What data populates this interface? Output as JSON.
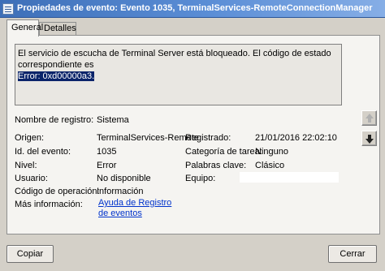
{
  "window": {
    "title": "Propiedades de evento: Evento 1035, TerminalServices-RemoteConnectionManager"
  },
  "tabs": [
    {
      "label": "General",
      "active": true
    },
    {
      "label": "Detalles",
      "active": false
    }
  ],
  "message": {
    "line1": "El servicio de escucha de Terminal Server está bloqueado. El código de estado correspondiente es",
    "line2_selected": "Error: 0xd00000a3."
  },
  "fields": {
    "nombre_registro": {
      "label": "Nombre de registro:",
      "value": "Sistema"
    },
    "origen": {
      "label": "Origen:",
      "value": "TerminalServices-Remote"
    },
    "registrado": {
      "label": "Registrado:",
      "value": "21/01/2016 22:02:10"
    },
    "id_evento": {
      "label": "Id. del evento:",
      "value": "1035"
    },
    "categoria_tarea": {
      "label": "Categoría de tarea:",
      "value": "Ninguno"
    },
    "nivel": {
      "label": "Nivel:",
      "value": "Error"
    },
    "palabras_clave": {
      "label": "Palabras clave:",
      "value": "Clásico"
    },
    "usuario": {
      "label": "Usuario:",
      "value": "No disponible"
    },
    "equipo": {
      "label": "Equipo:",
      "value": ""
    },
    "codigo_operacion": {
      "label": "Código de operación:",
      "value": "Información"
    },
    "mas_informacion": {
      "label": "Más información:",
      "link": "Ayuda de Registro de eventos"
    }
  },
  "buttons": {
    "copy": "Copiar",
    "close": "Cerrar"
  },
  "icons": {
    "scroll_up": "arrow-up-icon",
    "scroll_down": "arrow-down-icon"
  },
  "colors": {
    "titlebar": "#4a7dc4",
    "selection": "#0a246a",
    "link": "#0033cc"
  }
}
